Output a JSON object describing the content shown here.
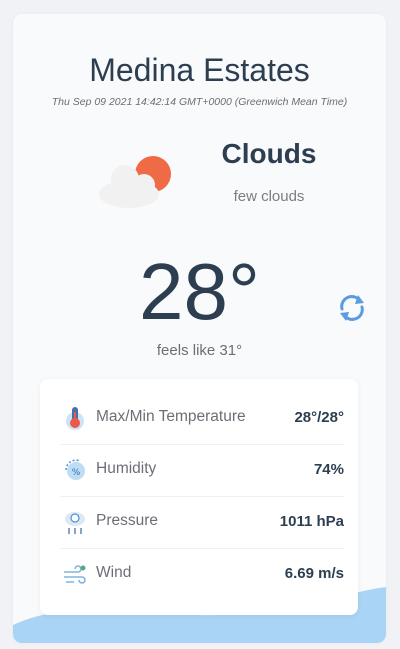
{
  "city": "Medina Estates",
  "datetime": "Thu Sep 09 2021 14:42:14 GMT+0000 (Greenwich Mean Time)",
  "weather": {
    "condition": "Clouds",
    "description": "few clouds",
    "icon": "sun-behind-cloud-icon"
  },
  "temperature": "28°",
  "feels_like": "feels like 31°",
  "refresh_icon": "refresh-icon",
  "details": [
    {
      "icon": "thermometer-icon",
      "label": "Max/Min Temperature",
      "value": "28°/28°"
    },
    {
      "icon": "humidity-icon",
      "label": "Humidity",
      "value": "74%"
    },
    {
      "icon": "pressure-icon",
      "label": "Pressure",
      "value": "1011 hPa"
    },
    {
      "icon": "wind-icon",
      "label": "Wind",
      "value": "6.69 m/s"
    }
  ],
  "colors": {
    "text_dark": "#2c3e50",
    "text_muted": "#6b6f75",
    "accent_blue": "#4a90d9",
    "sun_orange": "#ee6b45",
    "wave_blue": "#a9d4f5"
  }
}
